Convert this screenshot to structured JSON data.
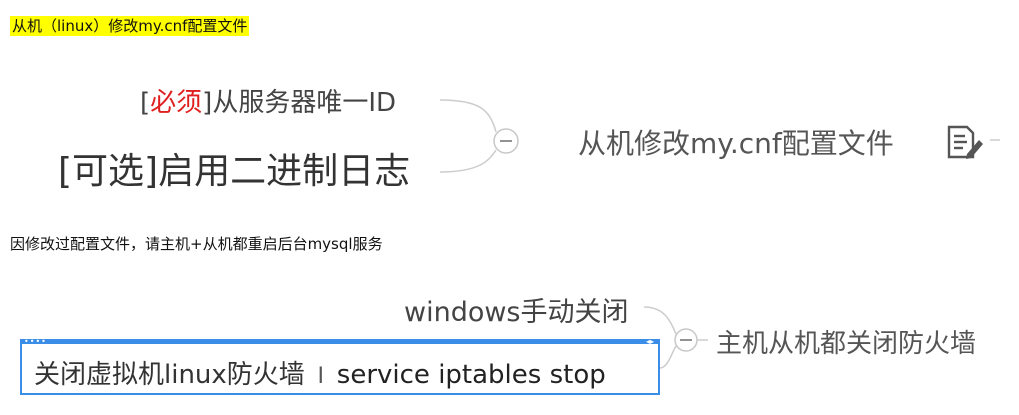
{
  "headings": {
    "first": "从机（linux）修改my.cnf配置文件",
    "second": "因修改过配置文件，请主机+从机都重启后台mysql服务"
  },
  "mindmap1": {
    "required_prefix_open": "[",
    "required_tag": "必须",
    "required_prefix_close": "]",
    "required_text": "从服务器唯一ID",
    "optional_text": "[可选]启用二进制日志",
    "main_node": "从机修改my.cnf配置文件",
    "collapse_symbol": "−"
  },
  "mindmap2": {
    "windows_node": "windows手动关闭",
    "edit_text": "关闭虚拟机linux防火墙",
    "cursor_glyph": "I",
    "command": "service iptables stop",
    "main_node": "主机从机都关闭防火墙",
    "collapse_symbol": "−"
  },
  "colors": {
    "highlight": "#ffff00",
    "required_red": "#e02020",
    "edit_border": "#3a8ee8",
    "connector": "#cccccc"
  },
  "icons": [
    "note-icon",
    "text-cursor-icon",
    "collapse-icon"
  ]
}
